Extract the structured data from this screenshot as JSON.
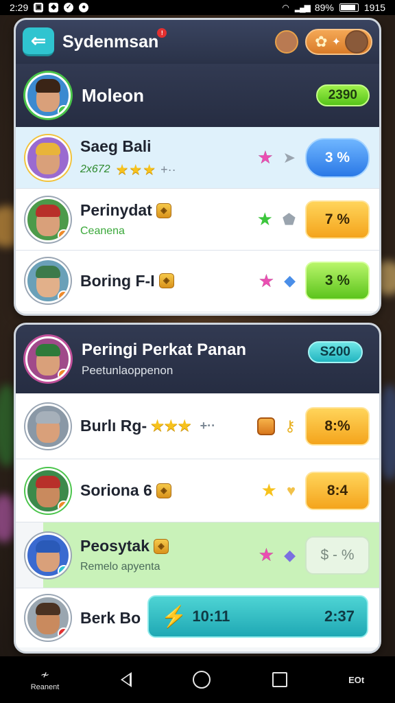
{
  "status_bar": {
    "time": "2:29",
    "battery_percent": "89%",
    "clock_right": "1915"
  },
  "top_panel": {
    "app_title": "Sydenmsan",
    "notification_count": "!",
    "header": {
      "name": "Moleon",
      "score": "2390"
    },
    "rows": [
      {
        "name": "Saeg Bali",
        "subtitle": "2x672",
        "subtitle_color": "#2e8a2e",
        "stars": "★★★",
        "plus": "+··",
        "percent": "3 %",
        "percent_style": "blue"
      },
      {
        "name": "Perinydat",
        "subtitle": "Ceanena",
        "subtitle_color": "#3aa83a",
        "percent": "7 %",
        "percent_style": "orange"
      },
      {
        "name": "Boring F-I",
        "percent": "3 %",
        "percent_style": "green"
      }
    ]
  },
  "bottom_panel": {
    "header": {
      "title": "Peringi Perkat Panan",
      "subtitle": "Peetunlaoppenon",
      "score": "S200"
    },
    "rows": [
      {
        "name": "Burlı Rg-",
        "stars": "★★★",
        "plus": "+··",
        "percent": "8:%",
        "percent_style": "orange"
      },
      {
        "name": "Soriona 6",
        "percent": "8:4",
        "percent_style": "orange"
      },
      {
        "name": "Peosytak",
        "subtitle": "Remelo apyenta",
        "subtitle_color": "#4a6a5a",
        "percent": "$ - %",
        "percent_style": "pale"
      },
      {
        "name": "Berk Bo",
        "action_time_left": "10:11",
        "action_time_right": "2:37"
      }
    ]
  },
  "nav": {
    "left_label": "Reanent",
    "right_label": "EOt"
  },
  "colors": {
    "accent_teal": "#2fc4d0",
    "header_navy": "#2a3248",
    "score_green": "#56c41a",
    "star_gold": "#f7c21c"
  }
}
